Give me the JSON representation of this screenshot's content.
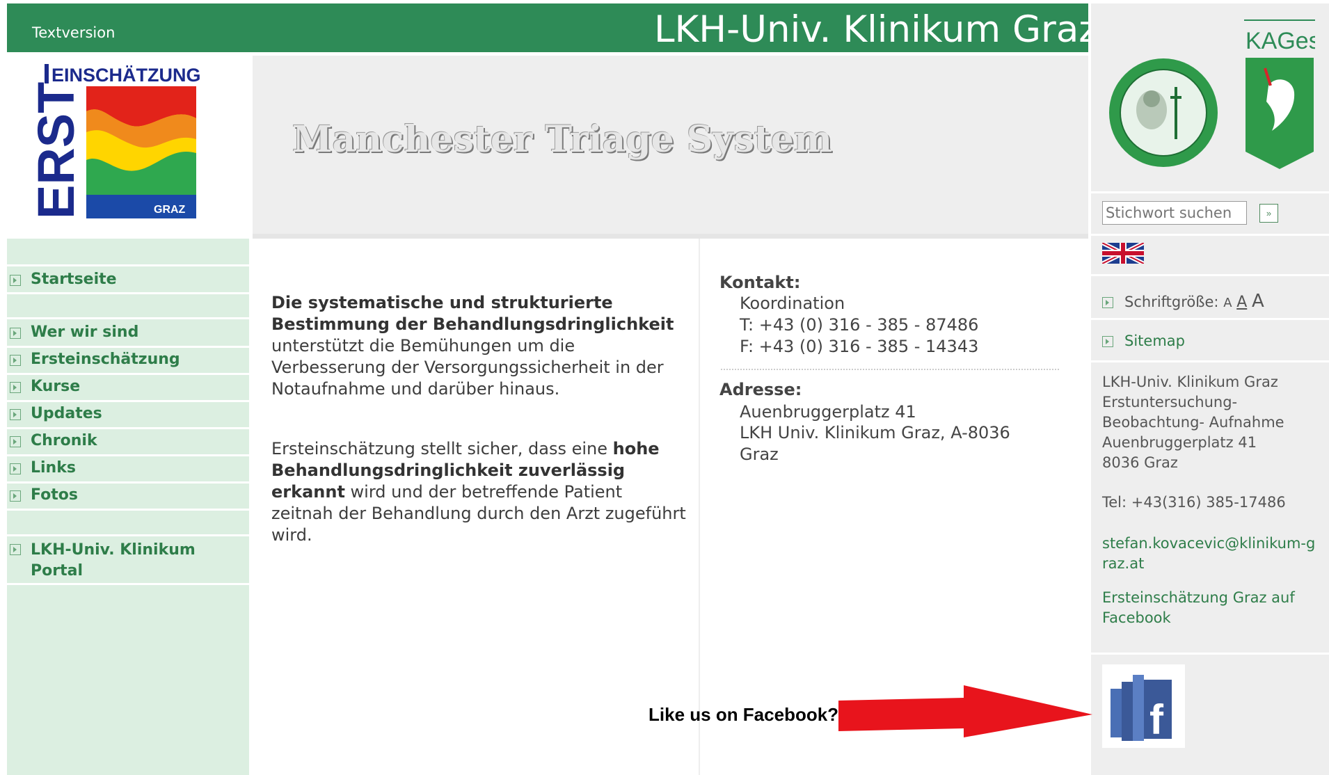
{
  "header": {
    "textversion": "Textversion",
    "site_title": "LKH-Univ. Klinikum Graz",
    "banner_title": "Manchester Triage System"
  },
  "logo": {
    "top_text": "EINSCHÄTZUNG",
    "side_text": "ERST",
    "bottom_text": "GRAZ"
  },
  "nav": {
    "items": [
      {
        "label": "Startseite"
      },
      {
        "label": "Wer wir sind"
      },
      {
        "label": "Ersteinschätzung"
      },
      {
        "label": "Kurse"
      },
      {
        "label": "Updates"
      },
      {
        "label": "Chronik"
      },
      {
        "label": "Links"
      },
      {
        "label": "Fotos"
      },
      {
        "label": "LKH-Univ. Klinikum Portal"
      }
    ]
  },
  "content": {
    "p1_bold": "Die systematische und strukturierte Bestimmung der Behandlungsdringlichkeit",
    "p1_rest": " unterstützt die Bemühungen um die Verbesserung der Versorgungssicherheit in der Notaufnahme und darüber hinaus.",
    "p2_start": "Ersteinschätzung stellt sicher, dass eine ",
    "p2_bold": "hohe Behandlungsdringlichkeit zuverlässig erkannt",
    "p2_end": " wird und der betreffende Patient zeitnah der Behandlung durch den Arzt zugeführt wird."
  },
  "contact": {
    "kontakt_label": "Kontakt:",
    "koordination": "Koordination",
    "tel": "T: +43 (0) 316 - 385 - 87486",
    "fax": "F: +43 (0) 316 - 385 - 14343",
    "adresse_label": "Adresse:",
    "street": "Auenbruggerplatz 41",
    "city_line": "LKH Univ. Klinikum Graz, A-8036",
    "city": "Graz"
  },
  "sidebar": {
    "org_logo_text": "KAGes",
    "search_placeholder": "Stichwort suchen",
    "search_button": "»",
    "font_size_label": "Schriftgröße:",
    "font_small": "A",
    "font_medium": "A",
    "font_large": "A",
    "sitemap": "Sitemap",
    "address_lines": [
      "LKH-Univ. Klinikum Graz",
      "Erstuntersuchung-",
      "Beobachtung- Aufnahme",
      "Auenbruggerplatz 41",
      "8036 Graz"
    ],
    "tel": "Tel: +43(316) 385-17486",
    "email": "stefan.kovacevic@klinikum-graz.at",
    "facebook_link": "Ersteinschätzung Graz auf Facebook"
  },
  "annotation": {
    "like_text": "Like us on Facebook?!"
  },
  "colors": {
    "header_green": "#2e8b57",
    "nav_bg": "#dcefe1",
    "link_green": "#2e7d49",
    "arrow_red": "#e8141c"
  }
}
